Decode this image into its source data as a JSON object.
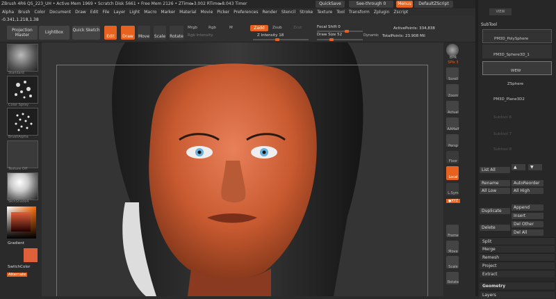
{
  "top": {
    "info": "ZBrush 4R6     QS_223_UH   • Active Mem 1969 • Scratch Disk 5661 • Free Mem 2126 • ZTime▸3.002 RTime▸8.043 Timer",
    "quicksave": "QuickSave",
    "seethrough": "See-through  0",
    "menus": "Menus",
    "script": "DefaultZScript"
  },
  "menu": [
    "Alpha",
    "Brush",
    "Color",
    "Document",
    "Draw",
    "Edit",
    "File",
    "Layer",
    "Light",
    "Macro",
    "Marker",
    "Material",
    "Movie",
    "Picker",
    "Preferences",
    "Render",
    "Stencil",
    "Stroke",
    "Texture",
    "Tool",
    "Transform",
    "Zplugin",
    "Zscript"
  ],
  "toolbar": {
    "coords": "-0.341,1.218,1.38",
    "projection": "Projection Master",
    "lightbox": "LightBox",
    "quicksketch": "Quick Sketch",
    "edit": "Edit",
    "draw": "Draw",
    "move": "Move",
    "scale": "Scale",
    "rotate": "Rotate",
    "mrgb": "Mrgb",
    "rgb": "Rgb",
    "m": "M",
    "zadd": "Zadd",
    "zsub": "Zsub",
    "zcut": "Zcut",
    "rgbint": "Rgb Intensity",
    "zint": "Z Intensity 18",
    "focal": "Focal Shift 0",
    "drawsize": "Draw Size 52",
    "dynamic": "Dynamic",
    "active": "ActivePoints: 334,838",
    "total": "TotalPoints: 23.908 Mil"
  },
  "left": {
    "standard": "Standard",
    "colorspray": "Color Spray",
    "brushalpha": "BrushAlpha",
    "textureoff": "Texture Off",
    "skinshade": "SkinShade4",
    "gradient": "Gradient",
    "switchcolor": "SwitchColor",
    "alternate": "Alternate"
  },
  "right": {
    "bpr": "BPR",
    "spix": "SPix 3",
    "scroll": "Scroll",
    "zoom": "Zoom",
    "actual": "Actual",
    "aahalf": "AAHalf",
    "persp": "Persp",
    "floor": "Floor",
    "local": "Local",
    "lsym": "L.Sym",
    "xyz": "●XYZ",
    "frame": "Frame",
    "move": "Move",
    "scale": "Scale",
    "rotate": "Rotate"
  },
  "subtool": {
    "header": "SubTool",
    "view": "VIEW",
    "items": [
      "PM3D_PolySphere",
      "PM3D_Sphere3D_1",
      "WEW",
      "ZSphere",
      "PM3D_Plane3D2",
      "Subtool 6",
      "Subtool 7",
      "Subtool 8"
    ],
    "listall": "List All",
    "rename": "Rename",
    "autoreorder": "AutoReorder",
    "alllow": "All Low",
    "allhigh": "All High",
    "duplicate": "Duplicate",
    "append": "Append",
    "insert": "Insert",
    "delete": "Delete",
    "delother": "Del Other",
    "delall": "Del All",
    "split": "Split",
    "merge": "Merge",
    "remesh": "Remesh",
    "project": "Project",
    "extract": "Extract",
    "geometry": "Geometry",
    "layers": "Layers"
  },
  "colors": {
    "accent": "#e8621f",
    "skin": "#d0643a"
  }
}
